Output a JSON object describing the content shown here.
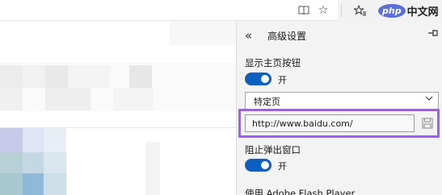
{
  "toolbar": {
    "reading_icon": "reading-view-icon",
    "favorite_icon": "star-icon",
    "favorites_hub_icon": "favorites-icon",
    "watermark_logo": "php",
    "watermark_text": "中文网"
  },
  "panel": {
    "title": "高级设置",
    "back_icon": "double-chevron-left-icon",
    "pin_icon": "pin-icon",
    "home_button": {
      "label": "显示主页按钮",
      "toggle_state": "开",
      "toggle_on": true
    },
    "home_select": {
      "value": "特定页"
    },
    "home_url": {
      "value": "http://www.baidu.com/",
      "save_icon": "save-icon"
    },
    "popup_blocker": {
      "label": "阻止弹出窗口",
      "toggle_state": "开",
      "toggle_on": true
    },
    "flash": {
      "label": "使用 Adobe Flash Player"
    }
  },
  "colors": {
    "accent": "#0a5fbf",
    "highlight": "#9b5ff0",
    "panel_bg": "#f3f3f3"
  }
}
